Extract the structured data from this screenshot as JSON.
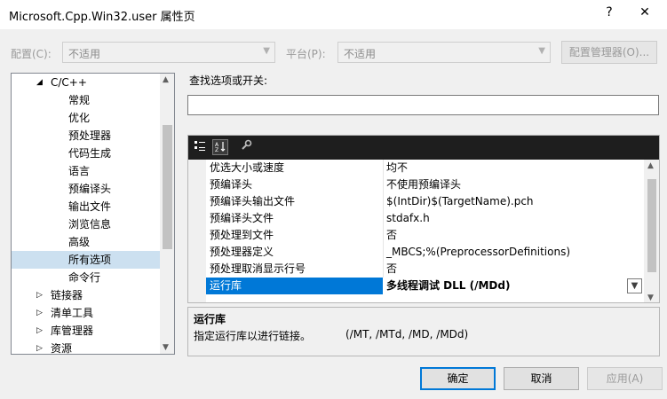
{
  "window": {
    "title": "Microsoft.Cpp.Win32.user 属性页",
    "help": "?",
    "close": "✕"
  },
  "config": {
    "config_label": "配置(C):",
    "config_value": "不适用",
    "platform_label": "平台(P):",
    "platform_value": "不适用",
    "manager_button": "配置管理器(O)..."
  },
  "tree": {
    "items": [
      {
        "label": "C/C++",
        "expander": "◢"
      },
      {
        "label": "常规"
      },
      {
        "label": "优化"
      },
      {
        "label": "预处理器"
      },
      {
        "label": "代码生成"
      },
      {
        "label": "语言"
      },
      {
        "label": "预编译头"
      },
      {
        "label": "输出文件"
      },
      {
        "label": "浏览信息"
      },
      {
        "label": "高级"
      },
      {
        "label": "所有选项"
      },
      {
        "label": "命令行"
      },
      {
        "label": "链接器",
        "expander": "▷"
      },
      {
        "label": "清单工具",
        "expander": "▷"
      },
      {
        "label": "库管理器",
        "expander": "▷"
      },
      {
        "label": "资源",
        "expander": "▷"
      }
    ]
  },
  "search": {
    "label": "查找选项或开关:",
    "value": ""
  },
  "properties": [
    {
      "name": "优选大小或速度",
      "value": "均不"
    },
    {
      "name": "预编译头",
      "value": "不使用预编译头"
    },
    {
      "name": "预编译头输出文件",
      "value": "$(IntDir)$(TargetName).pch"
    },
    {
      "name": "预编译头文件",
      "value": "stdafx.h"
    },
    {
      "name": "预处理到文件",
      "value": "否"
    },
    {
      "name": "预处理器定义",
      "value": "_MBCS;%(PreprocessorDefinitions)"
    },
    {
      "name": "预处理取消显示行号",
      "value": "否"
    },
    {
      "name": "运行库",
      "value": "多线程调试 DLL (/MDd)"
    }
  ],
  "description": {
    "title": "运行库",
    "text": "指定运行库以进行链接。",
    "options": "(/MT, /MTd, /MD, /MDd)"
  },
  "buttons": {
    "ok": "确定",
    "cancel": "取消",
    "apply": "应用(A)"
  }
}
